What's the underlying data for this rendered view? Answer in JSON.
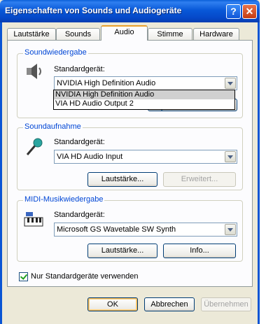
{
  "window": {
    "title": "Eigenschaften von Sounds und Audiogeräte",
    "help_glyph": "?",
    "close_glyph": "✕"
  },
  "tabs": [
    {
      "label": "Lautstärke"
    },
    {
      "label": "Sounds"
    },
    {
      "label": "Audio"
    },
    {
      "label": "Stimme"
    },
    {
      "label": "Hardware"
    }
  ],
  "playback": {
    "legend": "Soundwiedergabe",
    "label": "Standardgerät:",
    "selected": "NVIDIA High Definition Audio",
    "options": [
      "NVIDIA High Definition Audio",
      "VIA HD Audio Output 2"
    ]
  },
  "recording": {
    "legend": "Soundaufnahme",
    "label": "Standardgerät:",
    "selected": "VIA HD Audio Input",
    "volume_button": "Lautstärke...",
    "advanced_button": "Erweitert..."
  },
  "midi": {
    "legend": "MIDI-Musikwiedergabe",
    "label": "Standardgerät:",
    "selected": "Microsoft GS Wavetable SW Synth",
    "volume_button": "Lautstärke...",
    "info_button": "Info..."
  },
  "checkbox": {
    "label": "Nur Standardgeräte verwenden",
    "checked": true
  },
  "footer": {
    "ok": "OK",
    "cancel": "Abbrechen",
    "apply": "Übernehmen"
  }
}
